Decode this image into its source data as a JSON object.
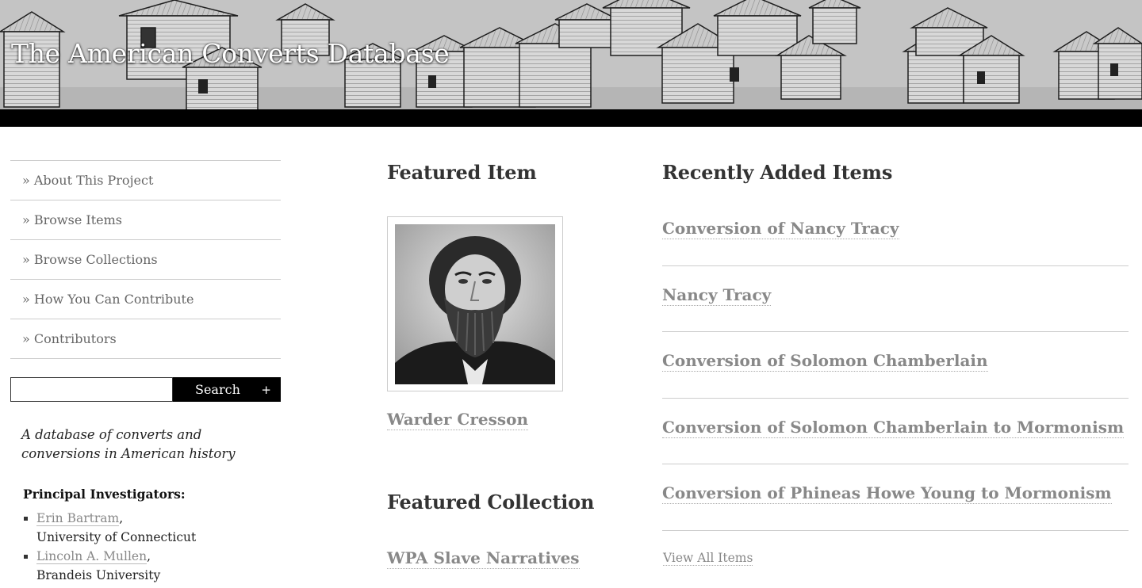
{
  "header": {
    "site_title": "The American Converts Database"
  },
  "sidebar": {
    "nav_items": [
      {
        "label": "» About This Project"
      },
      {
        "label": "» Browse Items"
      },
      {
        "label": "» Browse Collections"
      },
      {
        "label": "» How You Can Contribute"
      },
      {
        "label": "» Contributors"
      }
    ],
    "search": {
      "value": "",
      "button_label": "Search",
      "advanced_icon": "+"
    },
    "tagline": "A database of converts and conversions in American history",
    "investigators_heading": "Principal Investigators:",
    "investigators": [
      {
        "name": "Erin Bartram",
        "separator": ",",
        "affiliation": "University of Connecticut"
      },
      {
        "name": "Lincoln A. Mullen",
        "separator": ",",
        "affiliation": "Brandeis University"
      }
    ]
  },
  "featured": {
    "item_heading": "Featured Item",
    "item_image_icon": "portrait-photo",
    "item_title": "Warder Cresson",
    "collection_heading": "Featured Collection",
    "collection_title": "WPA Slave Narratives"
  },
  "recent": {
    "heading": "Recently Added Items",
    "items": [
      {
        "title": "Conversion of Nancy Tracy"
      },
      {
        "title": "Nancy Tracy"
      },
      {
        "title": "Conversion of Solomon Chamberlain"
      },
      {
        "title": "Conversion of Solomon Chamberlain to Mormonism"
      },
      {
        "title": "Conversion of Phineas Howe Young to Mormonism"
      }
    ],
    "view_all_label": "View All Items"
  },
  "colors": {
    "link": "#888888",
    "heading": "#333333",
    "banner_bar": "#000000",
    "search_button": "#000000"
  }
}
